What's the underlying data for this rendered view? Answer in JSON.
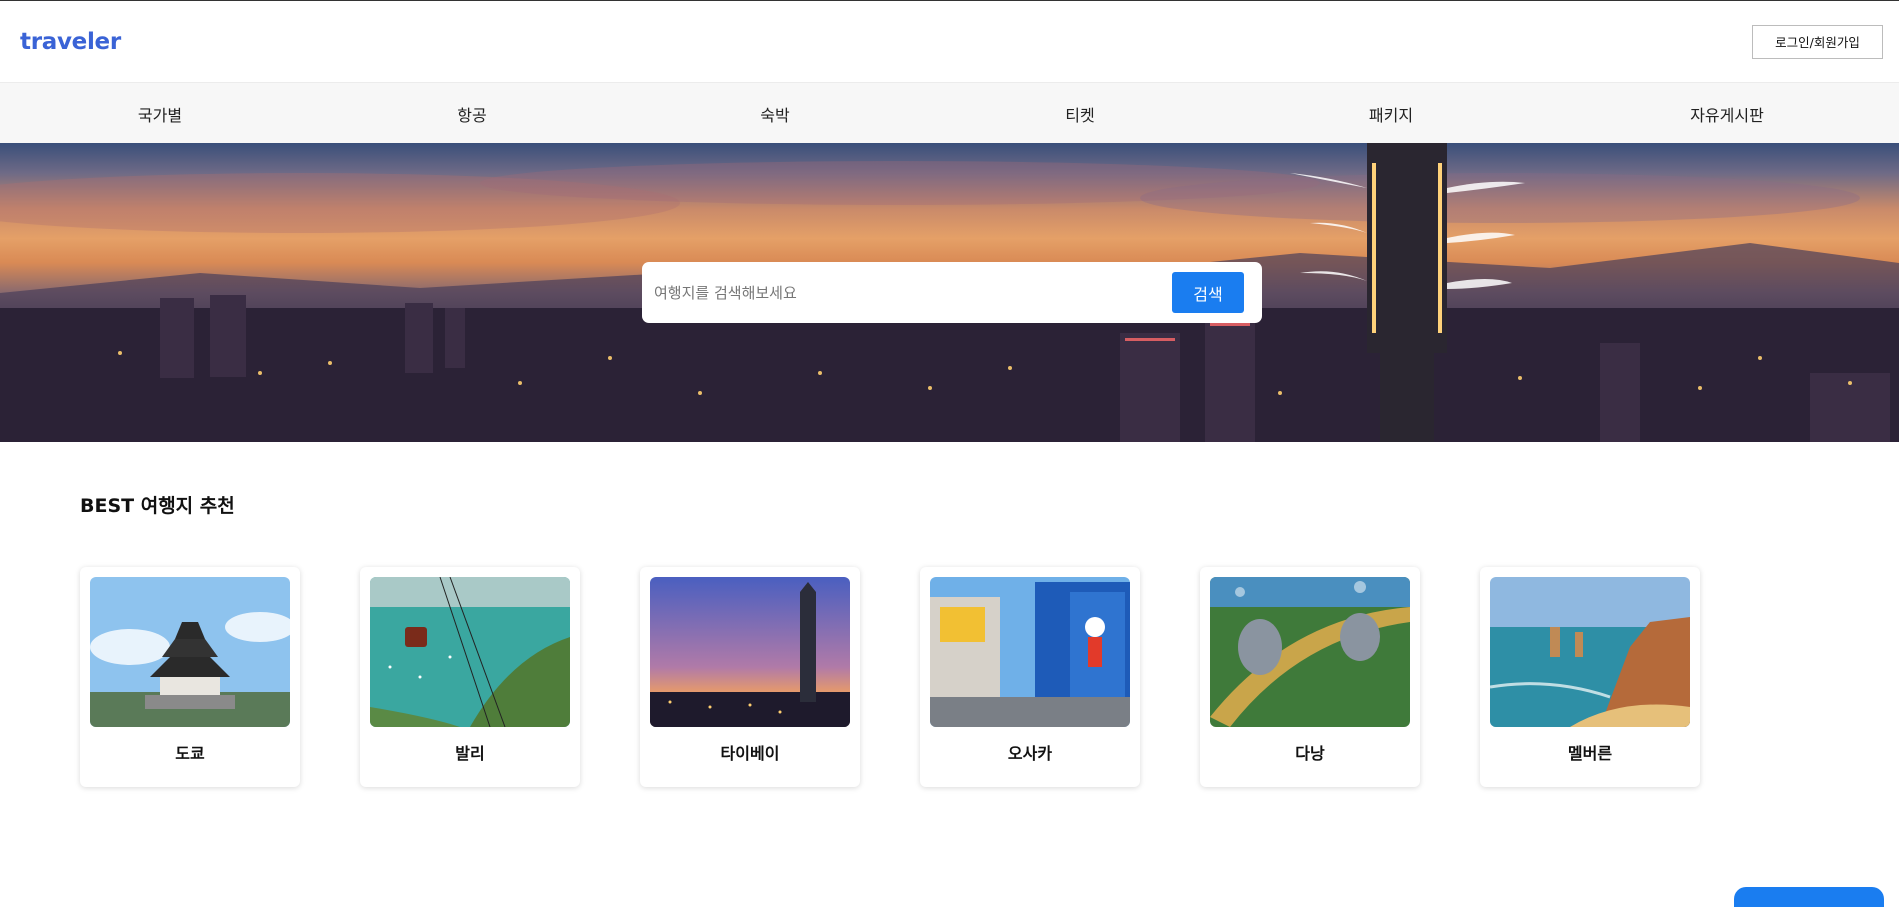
{
  "header": {
    "logo": "traveler",
    "login_label": "로그인/회원가입"
  },
  "nav": {
    "items": [
      "국가별",
      "항공",
      "숙박",
      "티켓",
      "패키지",
      "자유게시판"
    ]
  },
  "hero": {
    "search_placeholder": "여행지를 검색해보세요",
    "search_button": "검색"
  },
  "best": {
    "title": "BEST 여행지 추천",
    "cards": [
      {
        "name": "도쿄"
      },
      {
        "name": "발리"
      },
      {
        "name": "타이베이"
      },
      {
        "name": "오사카"
      },
      {
        "name": "다낭"
      },
      {
        "name": "멜버른"
      }
    ]
  },
  "colors": {
    "brand": "#3a63d6",
    "accent": "#1a7df0",
    "nav_bg": "#f7f7f7"
  }
}
